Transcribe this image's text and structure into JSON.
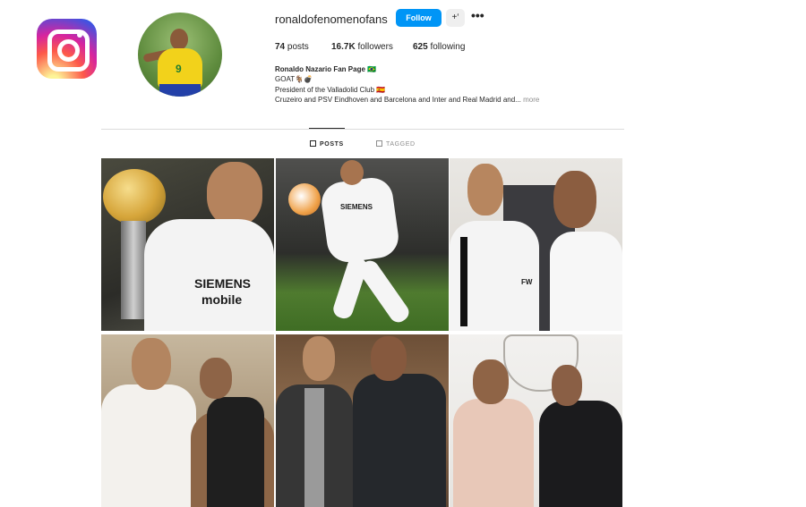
{
  "profile": {
    "username": "ronaldofenomenofans",
    "follow_label": "Follow",
    "add_user_glyph": "+‘",
    "more_glyph": "•••",
    "stats": {
      "posts_count": "74",
      "posts_label": "posts",
      "followers_count": "16.7K",
      "followers_label": "followers",
      "following_count": "625",
      "following_label": "following"
    },
    "bio": {
      "name": "Ronaldo Nazario Fan Page 🇧🇷",
      "line1": "GOAT🐐💣",
      "line2": "President of the Valladolid Club 🇪🇸",
      "line3": "Cruzeiro and PSV Eindhoven and Barcelona and Inter and Real Madrid and...",
      "more": "more"
    }
  },
  "tabs": {
    "posts": "POSTS",
    "tagged": "TAGGED"
  },
  "posts": {
    "p1": {
      "cap1": "SIEMENS",
      "cap2": "mobile"
    },
    "p2": {
      "cap1": "SIEMENS"
    },
    "p3": {
      "cap1": "FW"
    }
  },
  "colors": {
    "follow_button": "#0095f6",
    "text": "#262626",
    "muted": "#8e8e8e",
    "divider": "#dbdbdb"
  },
  "icons": {
    "logo": "instagram-logo-icon",
    "posts_tab": "grid-icon",
    "tagged_tab": "tag-icon"
  }
}
